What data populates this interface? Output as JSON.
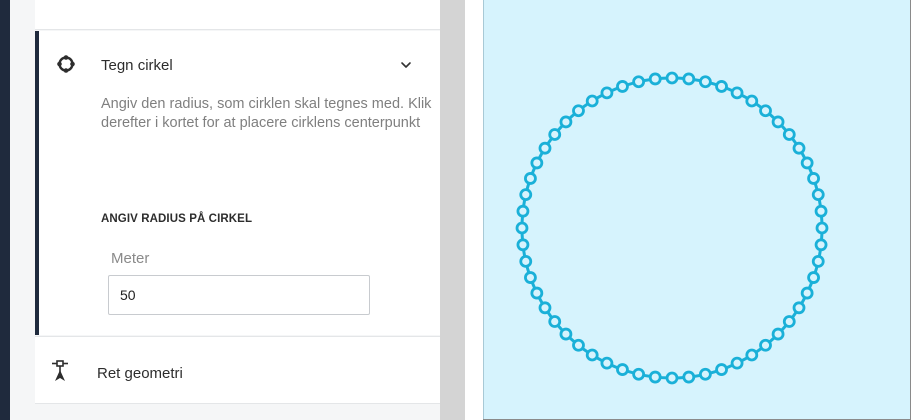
{
  "tools": {
    "draw_circle": {
      "title": "Tegn cirkel",
      "icon": "circle-tool-icon",
      "expanded": true,
      "description": "Angiv den radius, som cirklen skal tegnes med. Klik derefter i kortet for at placere cirklens centerpunkt",
      "radius_section_label": "ANGIV RADIUS PÅ CIRKEL",
      "unit_label": "Meter",
      "radius_value": "50"
    },
    "edit_geometry": {
      "title": "Ret geometri",
      "icon": "edit-geometry-icon"
    }
  },
  "colors": {
    "accent": "#1f2a3d",
    "map_background": "#d6f3fd",
    "circle_stroke": "#1ab0d8"
  },
  "map": {
    "vertex_count": 56
  }
}
